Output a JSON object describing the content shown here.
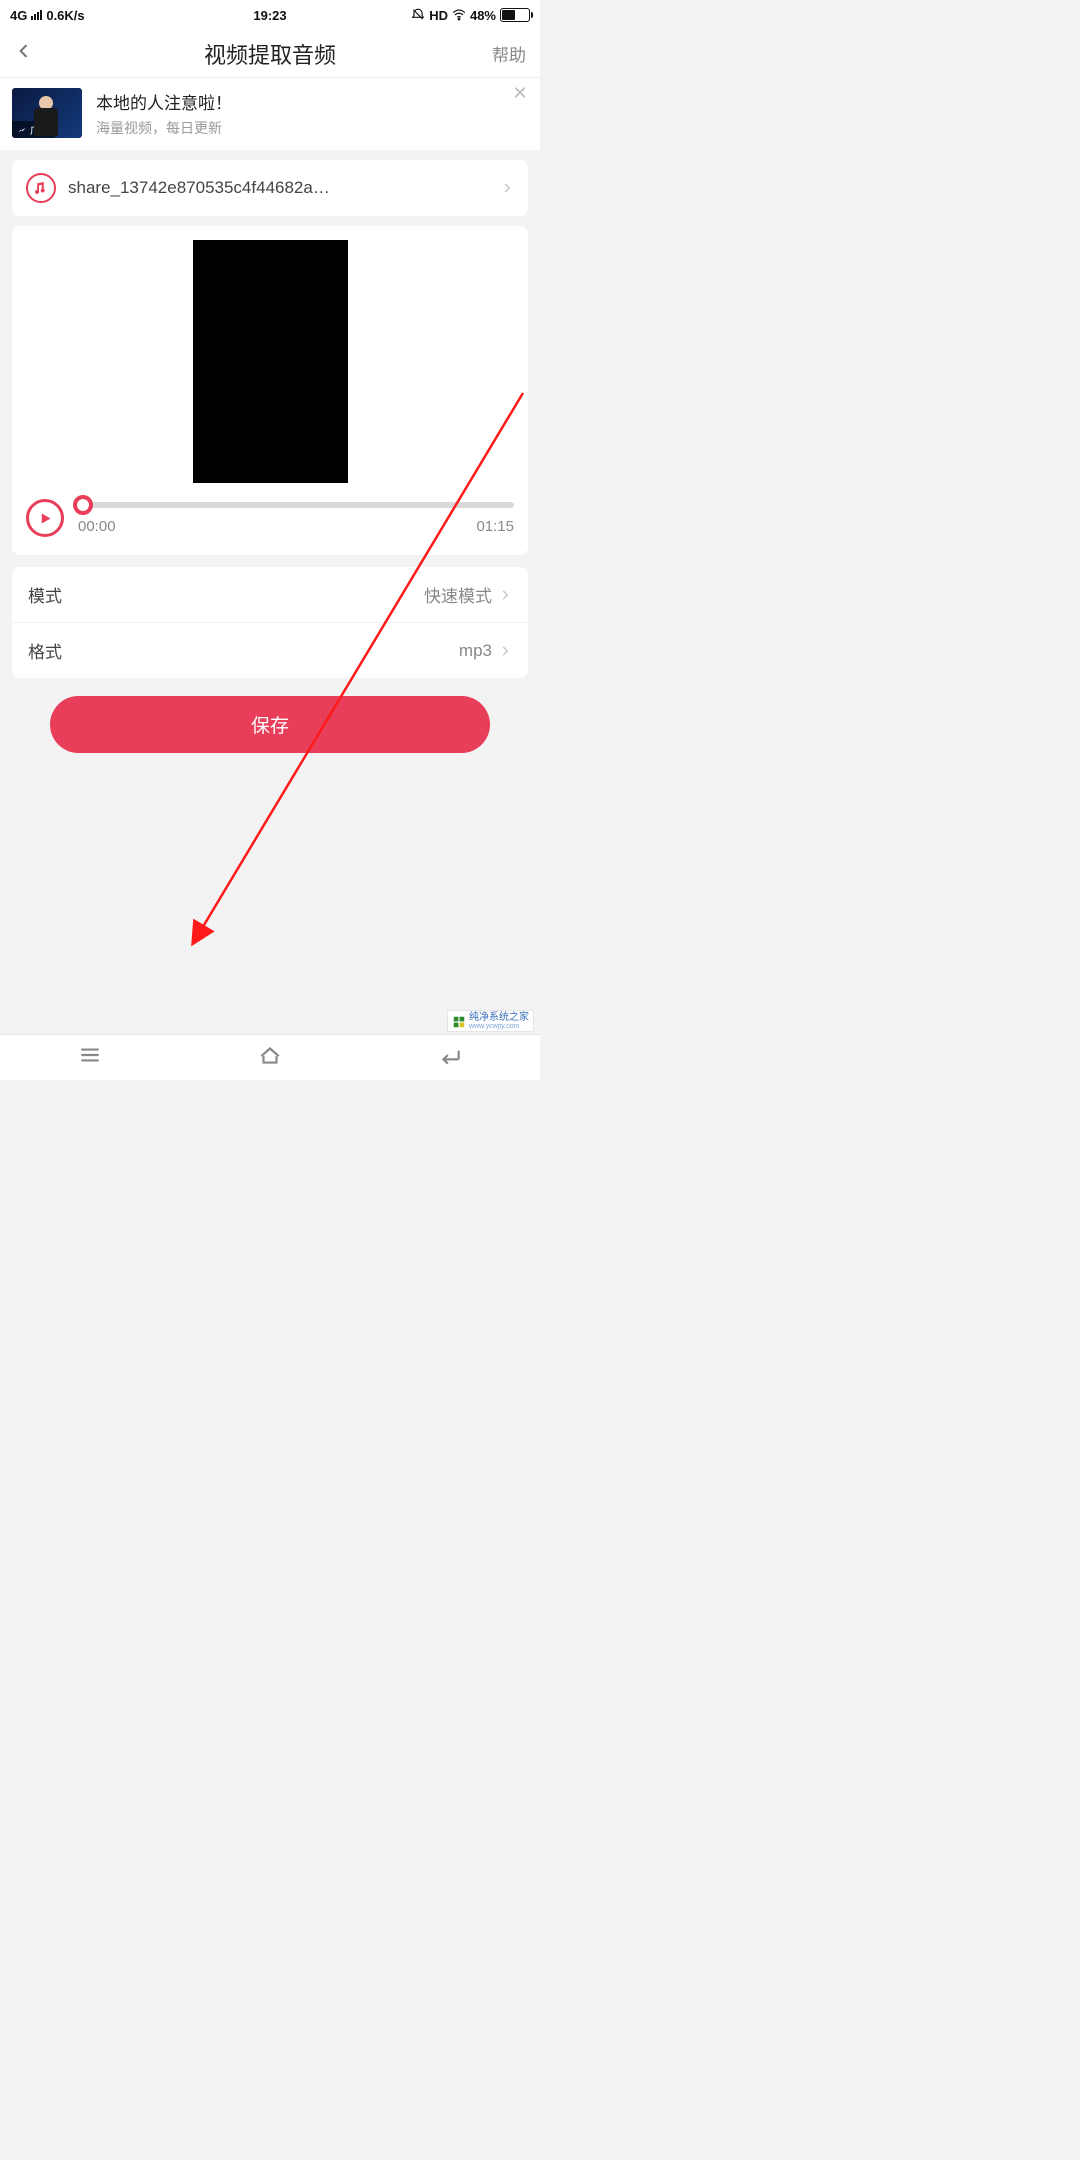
{
  "status": {
    "network": "4G",
    "speed": "0.6K/s",
    "time": "19:23",
    "hd": "HD",
    "battery_pct": "48%"
  },
  "header": {
    "title": "视频提取音频",
    "help": "帮助"
  },
  "ad": {
    "tag": "广告",
    "title": "本地的人注意啦！",
    "subtitle": "海量视频，每日更新"
  },
  "file": {
    "name": "share_13742e870535c4f44682a…"
  },
  "player": {
    "current": "00:00",
    "duration": "01:15"
  },
  "options": {
    "mode_label": "模式",
    "mode_value": "快速模式",
    "format_label": "格式",
    "format_value": "mp3"
  },
  "save_label": "保存",
  "watermark": {
    "text": "纯净系统之家",
    "url": "www.ycwjty.com"
  }
}
